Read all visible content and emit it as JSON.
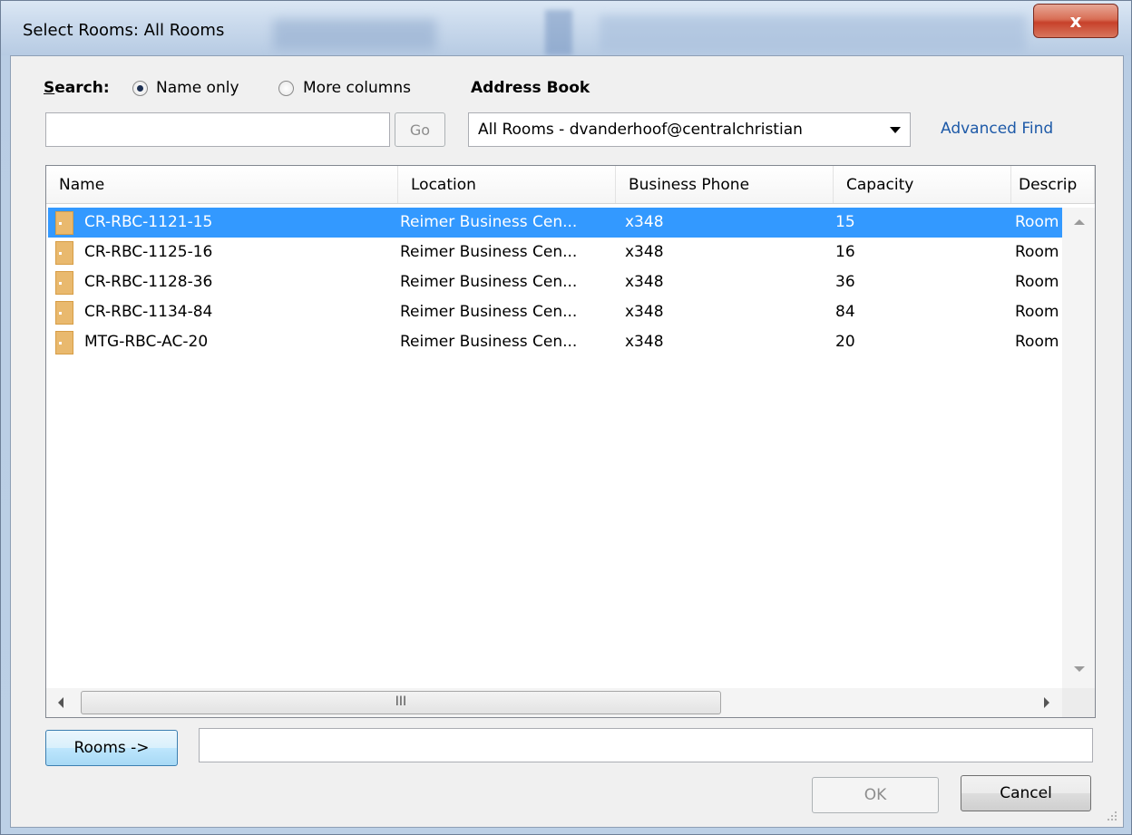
{
  "window": {
    "title": "Select Rooms: All Rooms",
    "close_glyph": "x"
  },
  "search": {
    "label": "Search:",
    "options": [
      {
        "label": "Name only",
        "checked": true
      },
      {
        "label": "More columns",
        "checked": false
      }
    ],
    "input_value": "",
    "go_label": "Go"
  },
  "address_book": {
    "label": "Address Book",
    "selected": "All Rooms - dvanderhoof@centralchristian",
    "advanced_find": "Advanced Find"
  },
  "list": {
    "columns": [
      "Name",
      "Location",
      "Business Phone",
      "Capacity",
      "Descrip"
    ],
    "rows": [
      {
        "name": "CR-RBC-1121-15",
        "location": "Reimer Business Cen...",
        "phone": "x348",
        "capacity": "15",
        "description": "Room",
        "selected": true
      },
      {
        "name": "CR-RBC-1125-16",
        "location": "Reimer Business Cen...",
        "phone": "x348",
        "capacity": "16",
        "description": "Room",
        "selected": false
      },
      {
        "name": "CR-RBC-1128-36",
        "location": "Reimer Business Cen...",
        "phone": "x348",
        "capacity": "36",
        "description": "Room",
        "selected": false
      },
      {
        "name": "CR-RBC-1134-84",
        "location": "Reimer Business Cen...",
        "phone": "x348",
        "capacity": "84",
        "description": "Room",
        "selected": false
      },
      {
        "name": "MTG-RBC-AC-20",
        "location": "Reimer Business Cen...",
        "phone": "x348",
        "capacity": "20",
        "description": "Room",
        "selected": false
      }
    ],
    "hscroll_thumb_glyph": "III"
  },
  "bottom": {
    "rooms_button": "Rooms ->",
    "rooms_value": "",
    "ok_label": "OK",
    "cancel_label": "Cancel"
  },
  "icons": {
    "room": "room-icon",
    "dropdown": "chevron-down-icon"
  },
  "colors": {
    "selection": "#3399ff",
    "link": "#1e5aa8",
    "close": "#c7412a"
  }
}
